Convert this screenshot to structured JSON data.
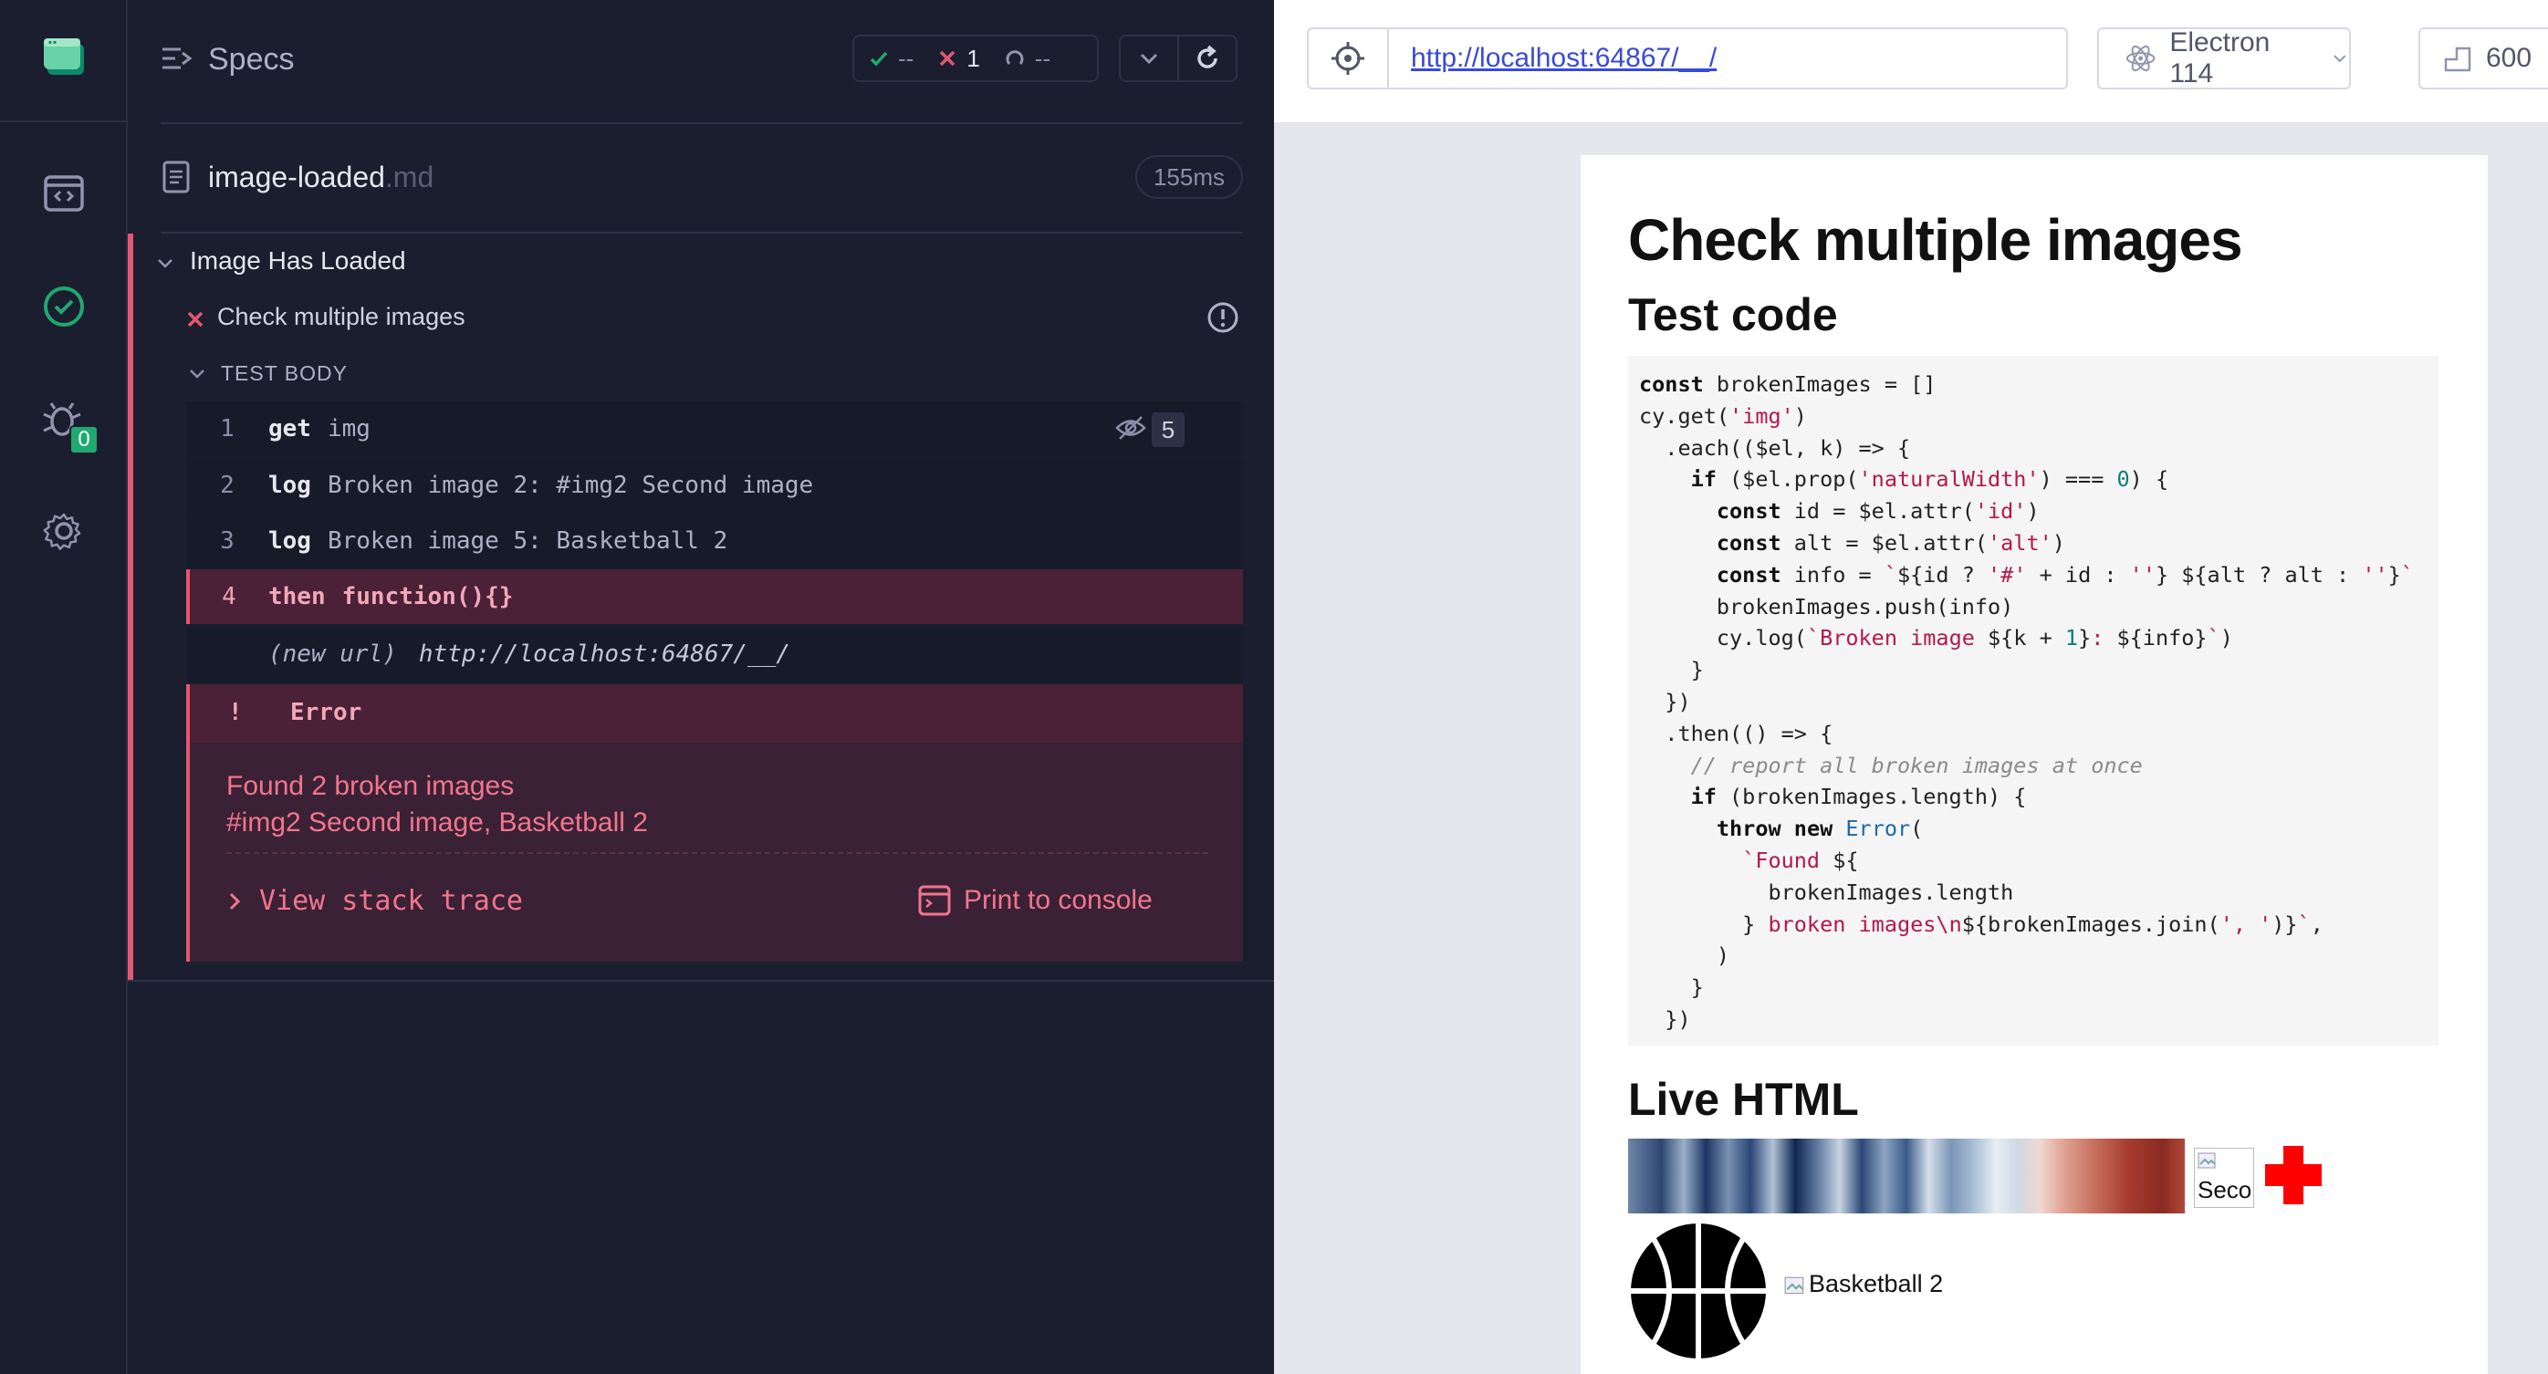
{
  "nav": {
    "debug_badge": "0"
  },
  "header": {
    "title": "Specs",
    "stats": {
      "passed": "--",
      "failed": "1",
      "pending": "--"
    }
  },
  "spec": {
    "name": "image-loaded",
    "ext": ".md",
    "duration": "155ms"
  },
  "suite": {
    "title": "Image Has Loaded",
    "test_title": "Check multiple images",
    "section_label": "TEST BODY"
  },
  "commands": [
    {
      "num": "1",
      "name": "get",
      "message": "img",
      "badge": "5"
    },
    {
      "num": "2",
      "name": "log",
      "message": "Broken image 2: #img2 Second image"
    },
    {
      "num": "3",
      "name": "log",
      "message": "Broken image 5: Basketball 2"
    },
    {
      "num": "4",
      "name": "then",
      "message": "function(){}"
    }
  ],
  "new_url": {
    "label": "(new url)",
    "url": "http://localhost:64867/__/"
  },
  "error": {
    "marker": "!",
    "title": "Error",
    "line1": "Found 2 broken images",
    "line2": "#img2 Second image,  Basketball 2",
    "stack_label": "View stack trace",
    "console_label": "Print to console"
  },
  "aut": {
    "url": "http://localhost:64867/__/",
    "browser": "Electron 114",
    "viewport": "600"
  },
  "page": {
    "h1": "Check multiple images",
    "h2_code": "Test code",
    "h2_live": "Live HTML",
    "img2_alt": "Seco",
    "img5_alt": "Basketball 2"
  },
  "colors": {
    "reporter_bg": "#1b1e2e",
    "fail_red": "#e45770",
    "pass_green": "#1fa971",
    "link_blue": "#3a4ad6"
  }
}
